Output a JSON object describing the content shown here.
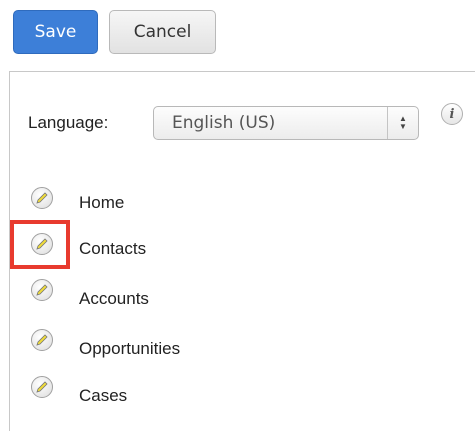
{
  "toolbar": {
    "save_label": "Save",
    "cancel_label": "Cancel"
  },
  "language": {
    "label": "Language:",
    "selected": "English (US)"
  },
  "info_icon": {
    "glyph": "i"
  },
  "modules": [
    {
      "label": "Home"
    },
    {
      "label": "Contacts"
    },
    {
      "label": "Accounts"
    },
    {
      "label": "Opportunities"
    },
    {
      "label": "Cases"
    }
  ],
  "colors": {
    "primary": "#3d7fd8",
    "highlight": "#e83a2e",
    "pencil": "#f0dc3a"
  }
}
